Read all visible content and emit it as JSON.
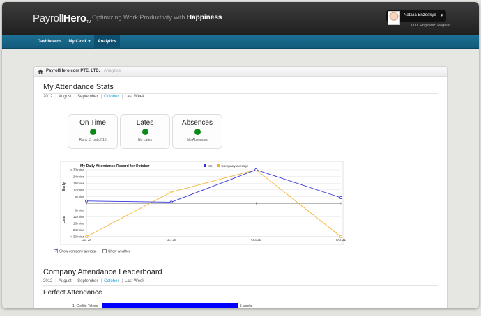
{
  "brand": {
    "logo_light": "Payroll",
    "logo_bold": "Hero",
    "logo_tm": "TM",
    "tagline_prefix": "Optimizing Work Productivity with ",
    "tagline_bold": "Happiness"
  },
  "user": {
    "name": "Natalia Enzeekye",
    "role": "UI/UX Engineer: Regular"
  },
  "nav": {
    "items": [
      {
        "label": "Dashboards"
      },
      {
        "label": "My Clock ▾"
      },
      {
        "label": "Analytics"
      }
    ]
  },
  "breadcrumb": {
    "company": "PayrollHero.com PTE. LTD.",
    "current": "Analytics"
  },
  "attendance": {
    "title": "My Attendance Stats",
    "filters": [
      "2012",
      "August",
      "September",
      "October",
      "Last Week"
    ],
    "selected_filter": "October",
    "cards": [
      {
        "title": "On Time",
        "status_color": "#0e8a1a",
        "subtitle": "Rank 11 out of 15"
      },
      {
        "title": "Lates",
        "status_color": "#0e8a1a",
        "subtitle": "No Lates"
      },
      {
        "title": "Absences",
        "status_color": "#0e8a1a",
        "subtitle": "No Absences"
      }
    ]
  },
  "chart_data": {
    "type": "line",
    "title": "My Daily Attendance Record for October",
    "categories": [
      "Oct 28",
      "Oct 29",
      "Oct 30",
      "Oct 31"
    ],
    "y_tick_labels": [
      "> 30 mins",
      "24 mins",
      "18 mins",
      "12 mins",
      "6 mins",
      "",
      "6 mins",
      "12 mins",
      "18 mins",
      "24 mins",
      "> 30 mins"
    ],
    "y_tick_values": [
      30,
      24,
      18,
      12,
      6,
      0,
      -6,
      -12,
      -18,
      -24,
      -30
    ],
    "ylabel_upper": "Early",
    "ylabel_lower": "Late",
    "ylim": [
      -30,
      30
    ],
    "legend_position": "top",
    "grid": true,
    "series": [
      {
        "name": "Me",
        "color": "#3333dd",
        "values": [
          2,
          1,
          30,
          5
        ]
      },
      {
        "name": "Company average",
        "color": "#f2b233",
        "values": [
          -30,
          10,
          30,
          -30
        ]
      }
    ]
  },
  "chart_options": {
    "show_company_average": "Show company average",
    "show_company_average_checked": true,
    "show_weather": "Show weather",
    "show_weather_checked": false
  },
  "leaderboard": {
    "title": "Company Attendance Leaderboard",
    "filters": [
      "2012",
      "August",
      "September",
      "October",
      "Last Week"
    ],
    "selected_filter": "October",
    "perfect_title": "Perfect Attendance",
    "entries": [
      {
        "name": "1. Ciellito Toledo",
        "weeks": 5,
        "label": "5 weeks"
      }
    ],
    "max_weeks": 5
  }
}
